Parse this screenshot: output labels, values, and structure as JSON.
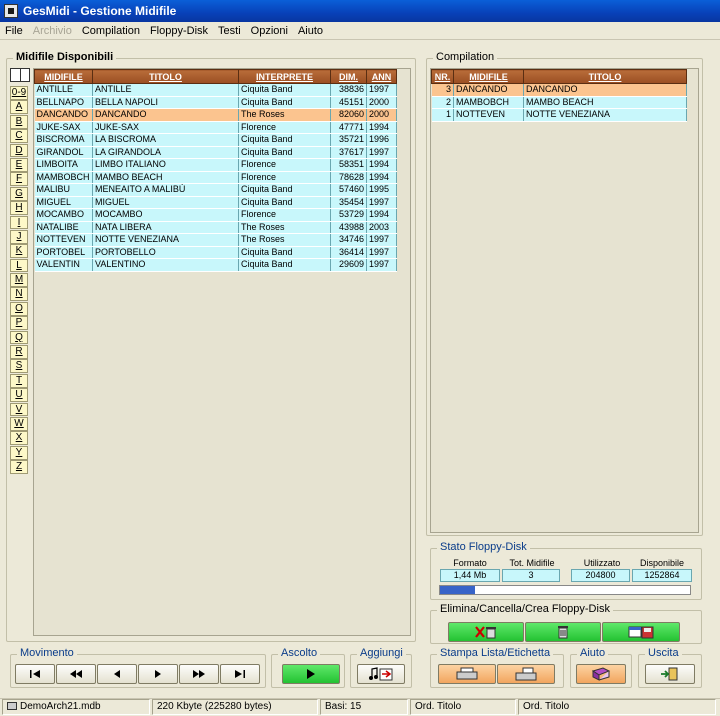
{
  "window": {
    "title": "GesMidi - Gestione Midifile"
  },
  "menu": [
    {
      "label": "File",
      "disabled": false
    },
    {
      "label": "Archivio",
      "disabled": true
    },
    {
      "label": "Compilation",
      "disabled": false
    },
    {
      "label": "Floppy-Disk",
      "disabled": false
    },
    {
      "label": "Testi",
      "disabled": false
    },
    {
      "label": "Opzioni",
      "disabled": false
    },
    {
      "label": "Aiuto",
      "disabled": false
    }
  ],
  "disponibili": {
    "title": "Midifile Disponibili",
    "columns": [
      "MIDIFILE",
      "TITOLO",
      "INTERPRETE",
      "DIM.",
      "ANN"
    ],
    "rows": [
      {
        "midifile": "ANTILLE",
        "titolo": "ANTILLE",
        "interprete": "Ciquita Band",
        "dim": "38836",
        "anno": "1997",
        "selected": false
      },
      {
        "midifile": "BELLNAPO",
        "titolo": "BELLA NAPOLI",
        "interprete": "Ciquita Band",
        "dim": "45151",
        "anno": "2000",
        "selected": false
      },
      {
        "midifile": "DANCANDO",
        "titolo": "DANCANDO",
        "interprete": "The Roses",
        "dim": "82060",
        "anno": "2000",
        "selected": true
      },
      {
        "midifile": "JUKE-SAX",
        "titolo": "JUKE-SAX",
        "interprete": "Florence",
        "dim": "47771",
        "anno": "1994",
        "selected": false
      },
      {
        "midifile": "BISCROMA",
        "titolo": "LA BISCROMA",
        "interprete": "Ciquita Band",
        "dim": "35721",
        "anno": "1996",
        "selected": false
      },
      {
        "midifile": "GIRANDOL",
        "titolo": "LA GIRANDOLA",
        "interprete": "Ciquita Band",
        "dim": "37617",
        "anno": "1997",
        "selected": false
      },
      {
        "midifile": "LIMBOITA",
        "titolo": "LIMBO ITALIANO",
        "interprete": "Florence",
        "dim": "58351",
        "anno": "1994",
        "selected": false
      },
      {
        "midifile": "MAMBOBCH",
        "titolo": "MAMBO BEACH",
        "interprete": "Florence",
        "dim": "78628",
        "anno": "1994",
        "selected": false
      },
      {
        "midifile": "MALIBU",
        "titolo": "MENEAITO A MALIBÙ",
        "interprete": "Ciquita Band",
        "dim": "57460",
        "anno": "1995",
        "selected": false
      },
      {
        "midifile": "MIGUEL",
        "titolo": "MIGUEL",
        "interprete": "Ciquita Band",
        "dim": "35454",
        "anno": "1997",
        "selected": false
      },
      {
        "midifile": "MOCAMBO",
        "titolo": "MOCAMBO",
        "interprete": "Florence",
        "dim": "53729",
        "anno": "1994",
        "selected": false
      },
      {
        "midifile": "NATALIBE",
        "titolo": "NATA LIBERA",
        "interprete": "The Roses",
        "dim": "43988",
        "anno": "2003",
        "selected": false
      },
      {
        "midifile": "NOTTEVEN",
        "titolo": "NOTTE VENEZIANA",
        "interprete": "The Roses",
        "dim": "34746",
        "anno": "1997",
        "selected": false
      },
      {
        "midifile": "PORTOBEL",
        "titolo": "PORTOBELLO",
        "interprete": "Ciquita Band",
        "dim": "36414",
        "anno": "1997",
        "selected": false
      },
      {
        "midifile": "VALENTIN",
        "titolo": "VALENTINO",
        "interprete": "Ciquita Band",
        "dim": "29609",
        "anno": "1997",
        "selected": false
      }
    ]
  },
  "letters": [
    "0-9",
    "A",
    "B",
    "C",
    "D",
    "E",
    "F",
    "G",
    "H",
    "I",
    "J",
    "K",
    "L",
    "M",
    "N",
    "O",
    "P",
    "Q",
    "R",
    "S",
    "T",
    "U",
    "V",
    "W",
    "X",
    "Y",
    "Z"
  ],
  "compilation": {
    "title": "Compilation",
    "columns": [
      "NR.",
      "MIDIFILE",
      "TITOLO"
    ],
    "rows": [
      {
        "nr": "3",
        "midifile": "DANCANDO",
        "titolo": "DANCANDO",
        "selected": true
      },
      {
        "nr": "2",
        "midifile": "MAMBOBCH",
        "titolo": "MAMBO BEACH",
        "selected": false
      },
      {
        "nr": "1",
        "midifile": "NOTTEVEN",
        "titolo": "NOTTE VENEZIANA",
        "selected": false
      }
    ]
  },
  "stato": {
    "title": "Stato Floppy-Disk",
    "labels": {
      "formato": "Formato",
      "tot": "Tot. Midifile",
      "utilizzato": "Utilizzato",
      "disponibile": "Disponibile"
    },
    "values": {
      "formato": "1,44 Mb",
      "tot": "3",
      "utilizzato": "204800",
      "disponibile": "1252864"
    },
    "usage_fraction": 0.14
  },
  "elimina": {
    "title": "Elimina/Cancella/Crea Floppy-Disk"
  },
  "movimento": {
    "title": "Movimento"
  },
  "ascolto": {
    "title": "Ascolto"
  },
  "aggiungi": {
    "title": "Aggiungi"
  },
  "stampa": {
    "title": "Stampa Lista/Etichetta"
  },
  "aiuto": {
    "title": "Aiuto"
  },
  "uscita": {
    "title": "Uscita"
  },
  "status": {
    "db": "DemoArch21.mdb",
    "size": "220 Kbyte  (225280 bytes)",
    "basi": "Basi: 15",
    "ord1": "Ord. Titolo",
    "ord2": "Ord. Titolo"
  },
  "colors": {
    "accent": "#0841b8",
    "grid_cell": "#c8f7fb",
    "selection": "#fbc48f",
    "header": "#9a4e22"
  }
}
